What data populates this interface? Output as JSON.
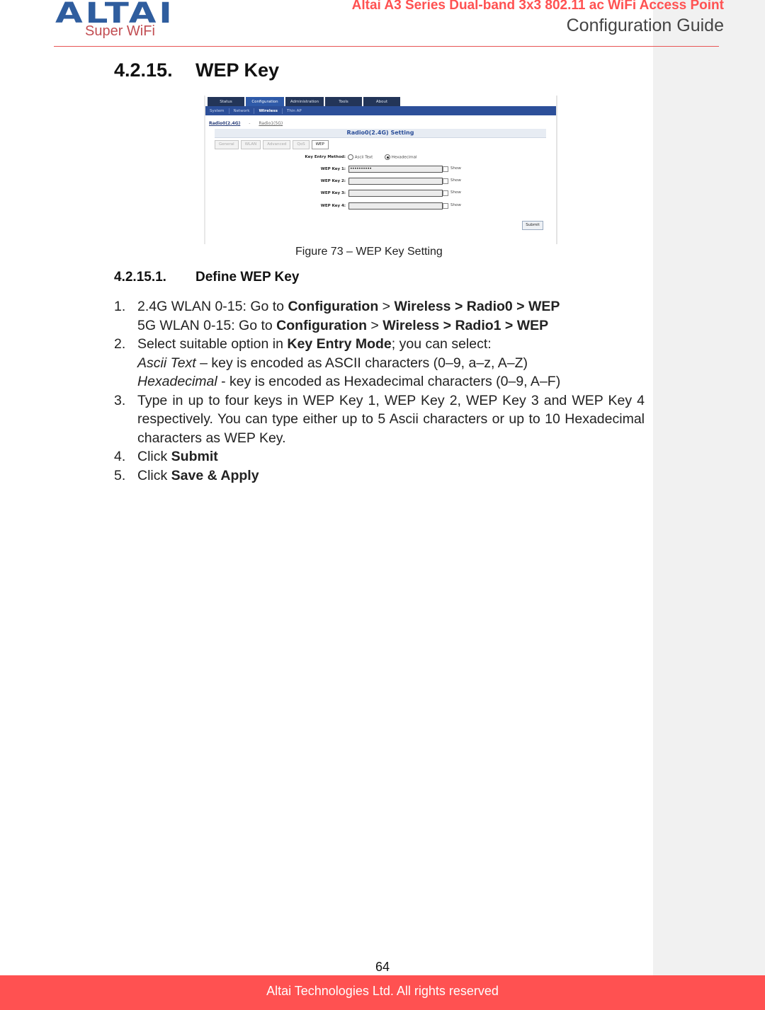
{
  "header": {
    "logo_text": "ALTAI",
    "logo_tagline": "Super WiFi",
    "product_title": "Altai A3 Series Dual-band 3x3 802.11 ac WiFi Access Point",
    "guide_title": "Configuration Guide"
  },
  "section": {
    "number": "4.2.15.",
    "title": "WEP Key"
  },
  "figure": {
    "main_tabs": [
      "Status",
      "Configuration",
      "Administration",
      "Tools",
      "About"
    ],
    "active_main_tab": "Configuration",
    "sub_nav": [
      "System",
      "Network",
      "Wireless",
      "Thin AP"
    ],
    "active_sub_nav": "Wireless",
    "radio_links": {
      "radio0": "Radio0(2.4G)",
      "separator": "-",
      "radio1": "Radio1(5G)"
    },
    "setting_title": "Radio0(2.4G) Setting",
    "sub_tabs": [
      "General",
      "WLAN",
      "Advanced",
      "QoS",
      "WEP"
    ],
    "active_sub_tab": "WEP",
    "key_entry_label": "Key Entry Method:",
    "key_entry_options": [
      "Ascii Text",
      "Hexadecimal"
    ],
    "key_entry_selected": "Hexadecimal",
    "keys": [
      {
        "label": "WEP Key 1:",
        "value": "••••••••••",
        "show_label": "Show"
      },
      {
        "label": "WEP Key 2:",
        "value": "",
        "show_label": "Show"
      },
      {
        "label": "WEP Key 3:",
        "value": "",
        "show_label": "Show"
      },
      {
        "label": "WEP Key 4:",
        "value": "",
        "show_label": "Show"
      }
    ],
    "submit_label": "Submit",
    "caption": "Figure 73 – WEP Key Setting"
  },
  "subsection": {
    "number": "4.2.15.1.",
    "title": "Define WEP Key"
  },
  "steps": {
    "s1": {
      "n": "1.",
      "l1_pre": "2.4G WLAN 0-15: Go to ",
      "l1_b1": "Configuration",
      "l1_mid": " > ",
      "l1_b2": "Wireless > Radio0 > WEP",
      "l2_pre": "5G WLAN 0-15: Go to ",
      "l2_b1": "Configuration",
      "l2_mid": " > ",
      "l2_b2": "Wireless > Radio1 > WEP"
    },
    "s2": {
      "n": "2.",
      "l1_pre": "Select suitable option in ",
      "l1_b": "Key Entry Mode",
      "l1_post": "; you can select:",
      "l2_i": "Ascii Text",
      "l2_post": " – key is encoded as ASCII characters (0–9, a–z, A–Z)",
      "l3_i": "Hexadecimal",
      "l3_post": " - key is encoded as Hexadecimal characters (0–9, A–F)"
    },
    "s3": {
      "n": "3.",
      "text": "Type in up to four keys in WEP Key 1, WEP Key 2, WEP Key 3 and WEP Key 4 respectively. You can type either up to 5 Ascii characters or up to 10 Hexadecimal characters as WEP Key."
    },
    "s4": {
      "n": "4.",
      "pre": "Click ",
      "b": "Submit"
    },
    "s5": {
      "n": "5.",
      "pre": "Click ",
      "b": "Save & Apply"
    }
  },
  "footer": {
    "page_number": "64",
    "copyright": "Altai Technologies Ltd. All rights reserved"
  },
  "colors": {
    "brand_red": "#ff5151",
    "logo_blue": "#2f5d9e",
    "nav_blue": "#2c4f99"
  }
}
